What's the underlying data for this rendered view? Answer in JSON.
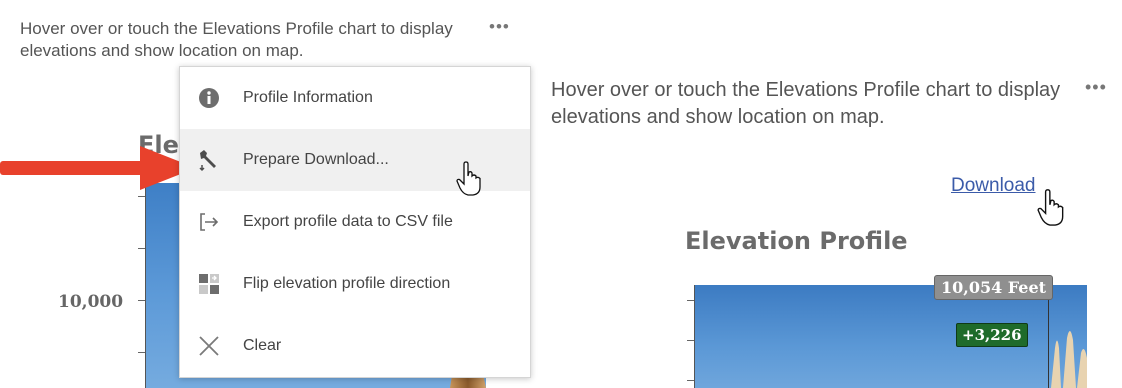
{
  "left_panel": {
    "instructions": "Hover over or touch the Elevations Profile chart to display elevations and show location on map.",
    "more_icon": "more-horizontal-icon",
    "chart_title_partial": "Ele",
    "y_tick_label": "10,000"
  },
  "context_menu": {
    "items": [
      {
        "label": "Profile Information",
        "icon": "info-circle-icon"
      },
      {
        "label": "Prepare Download...",
        "icon": "wrench-icon"
      },
      {
        "label": "Export profile data to CSV file",
        "icon": "export-icon"
      },
      {
        "label": "Flip elevation profile direction",
        "icon": "flip-icon"
      },
      {
        "label": "Clear",
        "icon": "close-icon"
      }
    ],
    "highlighted_index": 1
  },
  "right_panel": {
    "instructions": "Hover over or touch the Elevations Profile chart to display elevations and show location on map.",
    "more_icon": "more-horizontal-icon",
    "download_link": "Download",
    "chart_title": "Elevation Profile",
    "tooltip_elevation": "10,054 Feet",
    "tooltip_gain": "+3,226"
  },
  "colors": {
    "chart_blue": "#3e7fc6",
    "arrow_red": "#e8412c",
    "link_blue": "#3b5ba9",
    "gain_green": "#1f6b2a"
  }
}
